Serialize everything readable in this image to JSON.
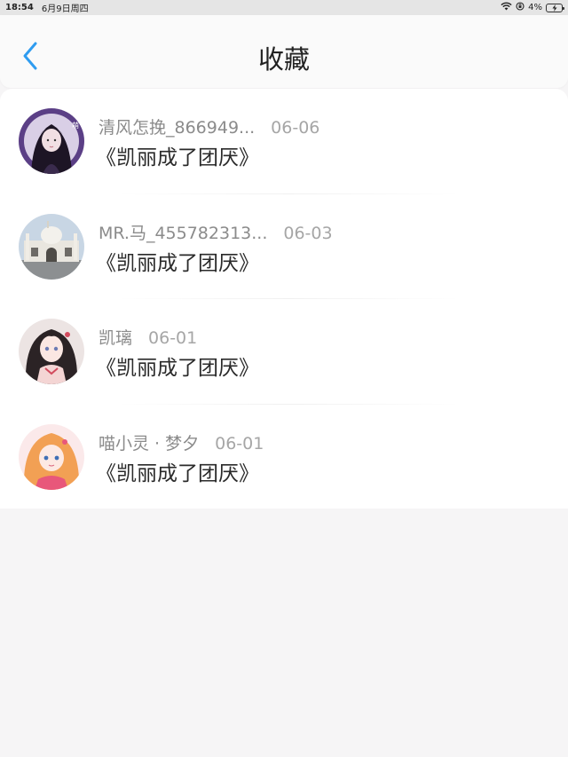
{
  "status_bar": {
    "time": "18:54",
    "date": "6月9日周四",
    "battery_percent": "4%",
    "icons": [
      "wifi-icon",
      "orientation-lock-icon",
      "battery-charging-icon"
    ]
  },
  "nav": {
    "back_icon": "chevron-left-icon",
    "title": "收藏",
    "accent_color": "#2f9cf0"
  },
  "favorites": [
    {
      "author": "清风怎挽_866949...",
      "date": "06-06",
      "title": "《凯丽成了团厌》",
      "avatar": "avatar-purple-girl"
    },
    {
      "author": "MR.马_455782313...",
      "date": "06-03",
      "title": "《凯丽成了团厌》",
      "avatar": "avatar-mosque"
    },
    {
      "author": "凯璃",
      "date": "06-01",
      "title": "《凯丽成了团厌》",
      "avatar": "avatar-anime-dark-hair"
    },
    {
      "author": "喵小灵 · 梦夕",
      "date": "06-01",
      "title": "《凯丽成了团厌》",
      "avatar": "avatar-anime-orange-hair"
    }
  ]
}
